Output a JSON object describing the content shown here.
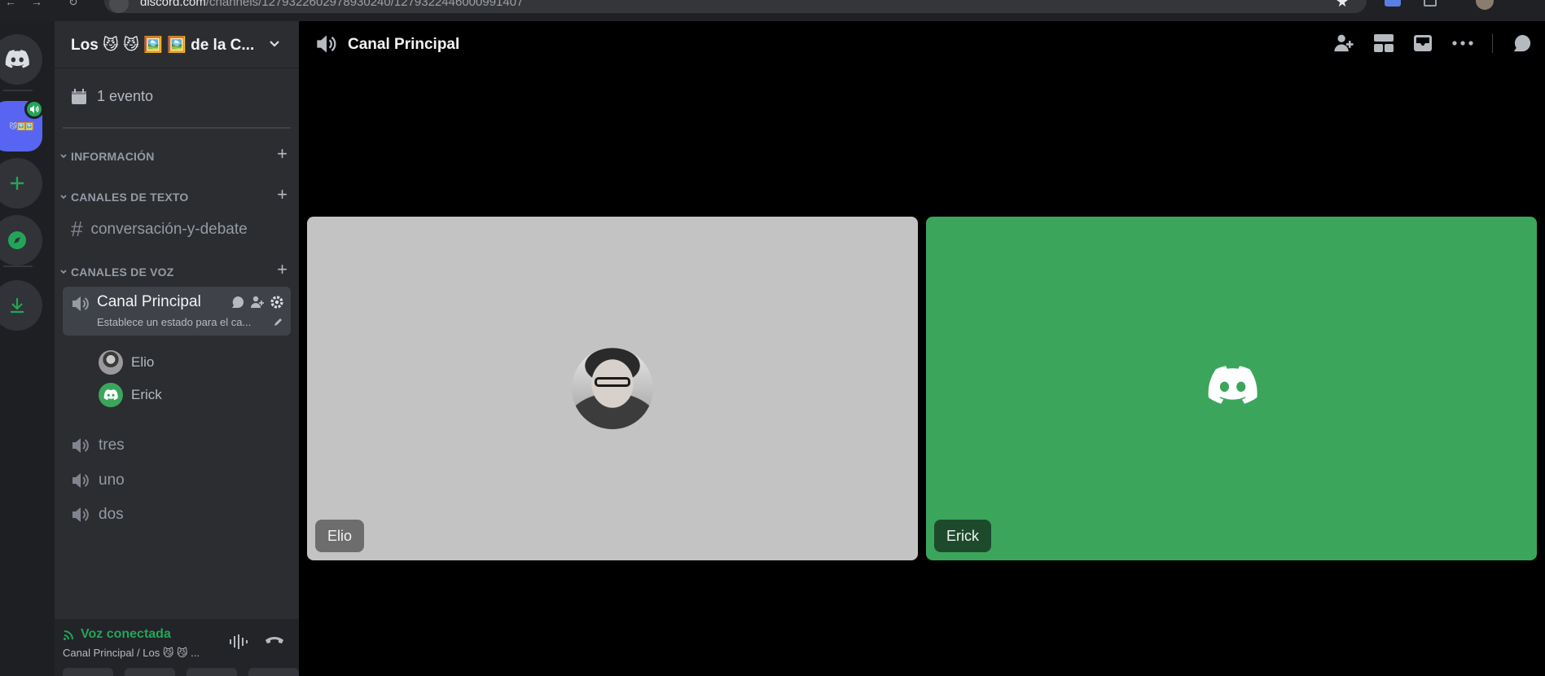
{
  "browser": {
    "url_domain": "discord.com",
    "url_path": "/channels/1279322602978930240/1279322446000991407"
  },
  "server": {
    "name": "Los 😼 😼 🖼️ 🖼️ de la C...",
    "rail_label": "😼🖼️🖼️"
  },
  "sidebar": {
    "events_label": "1 evento",
    "categories": [
      {
        "label": "INFORMACIÓN"
      },
      {
        "label": "CANALES DE TEXTO"
      },
      {
        "label": "CANALES DE VOZ"
      }
    ],
    "text_channels": [
      {
        "name": "conversación-y-debate"
      }
    ],
    "active_voice": {
      "name": "Canal Principal",
      "status": "Establece un estado para el ca...",
      "members": [
        {
          "name": "Elio"
        },
        {
          "name": "Erick"
        }
      ]
    },
    "voice_channels": [
      {
        "name": "tres"
      },
      {
        "name": "uno"
      },
      {
        "name": "dos"
      }
    ]
  },
  "voice_panel": {
    "status": "Voz conectada",
    "channel": "Canal Principal / Los 😼 😼 ..."
  },
  "main": {
    "title": "Canal Principal",
    "tiles": [
      {
        "name": "Elio"
      },
      {
        "name": "Erick"
      }
    ]
  },
  "colors": {
    "discord_blurple": "#5865f2",
    "online_green": "#23a559",
    "erick_tile": "#3ba55c",
    "elio_tile": "#c3c3c3"
  }
}
